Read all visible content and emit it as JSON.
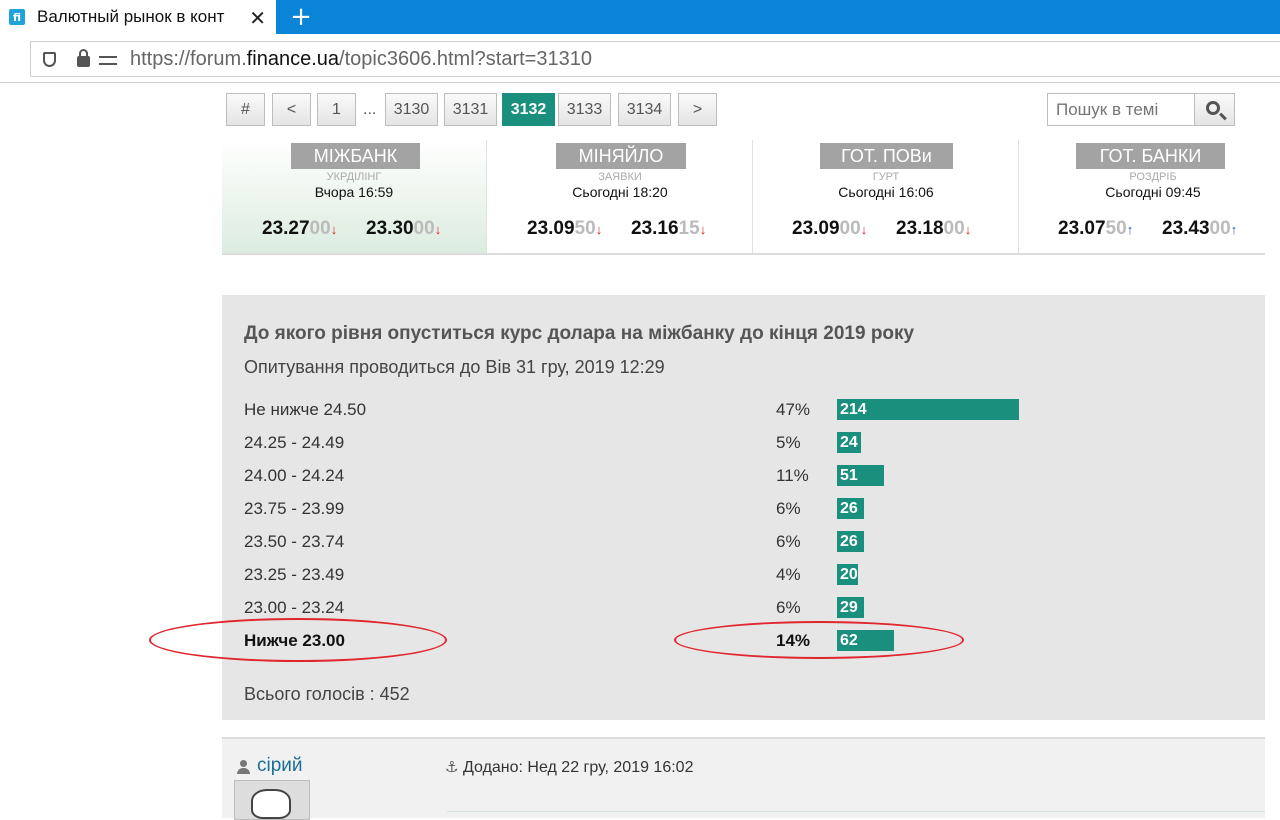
{
  "browser": {
    "tab_title": "Валютный рынок в конт",
    "favicon_text": "fi",
    "close_symbol": "✕",
    "new_tab_symbol": "+",
    "url_prefix": "https://forum.",
    "url_domain": "finance.ua",
    "url_path": "/topic3606.html?start=31310"
  },
  "pagination": {
    "hash": "#",
    "prev": "<",
    "first": "1",
    "ellipsis": "...",
    "pages": [
      "3130",
      "3131",
      "3132",
      "3133",
      "3134"
    ],
    "active": "3132",
    "next": ">"
  },
  "search": {
    "placeholder": "Пошук в темі"
  },
  "rates": [
    {
      "name": "МІЖБАНК",
      "sub": "УКРДІЛІНГ",
      "time": "Вчора 16:59",
      "buy_main": "23.27",
      "buy_dec": "00",
      "buy_dir": "↓",
      "sell_main": "23.30",
      "sell_dec": "00",
      "sell_dir": "↓"
    },
    {
      "name": "МІНЯЙЛО",
      "sub": "ЗАЯВКИ",
      "time": "Сьогодні 18:20",
      "buy_main": "23.09",
      "buy_dec": "50",
      "buy_dir": "↓",
      "sell_main": "23.16",
      "sell_dec": "15",
      "sell_dir": "↓"
    },
    {
      "name": "ГОТ. ПОВи",
      "sub": "ГУРТ",
      "time": "Сьогодні 16:06",
      "buy_main": "23.09",
      "buy_dec": "00",
      "buy_dir": "↓",
      "sell_main": "23.18",
      "sell_dec": "00",
      "sell_dir": "↓"
    },
    {
      "name": "ГОТ. БАНКИ",
      "sub": "РОЗДРІБ",
      "time": "Сьогодні 09:45",
      "buy_main": "23.07",
      "buy_dec": "50",
      "buy_dir": "↑",
      "sell_main": "23.43",
      "sell_dec": "00",
      "sell_dir": "↑"
    }
  ],
  "poll": {
    "title": "До якого рівня опуститься курс долара на міжбанку до кінця 2019 року",
    "subtitle": "Опитування проводиться до Вів 31 гру, 2019 12:29",
    "options": [
      {
        "label": "Не нижче 24.50",
        "percent": "47%",
        "votes": "214"
      },
      {
        "label": "24.25 - 24.49",
        "percent": "5%",
        "votes": "24"
      },
      {
        "label": "24.00 - 24.24",
        "percent": "11%",
        "votes": "51"
      },
      {
        "label": "23.75 - 23.99",
        "percent": "6%",
        "votes": "26"
      },
      {
        "label": "23.50 - 23.74",
        "percent": "6%",
        "votes": "26"
      },
      {
        "label": "23.25 - 23.49",
        "percent": "4%",
        "votes": "20"
      },
      {
        "label": "23.00 - 23.24",
        "percent": "6%",
        "votes": "29"
      },
      {
        "label": "Нижче 23.00",
        "percent": "14%",
        "votes": "62"
      }
    ],
    "total": "Всього голосів : 452"
  },
  "post": {
    "username": "сірий",
    "anchor_symbol": "⚓",
    "date": "Додано: Нед 22 гру, 2019 16:02"
  },
  "colors": {
    "accent": "#1b8f7d",
    "browser_blue": "#0a84d6",
    "annotation_red": "#e0262e"
  }
}
